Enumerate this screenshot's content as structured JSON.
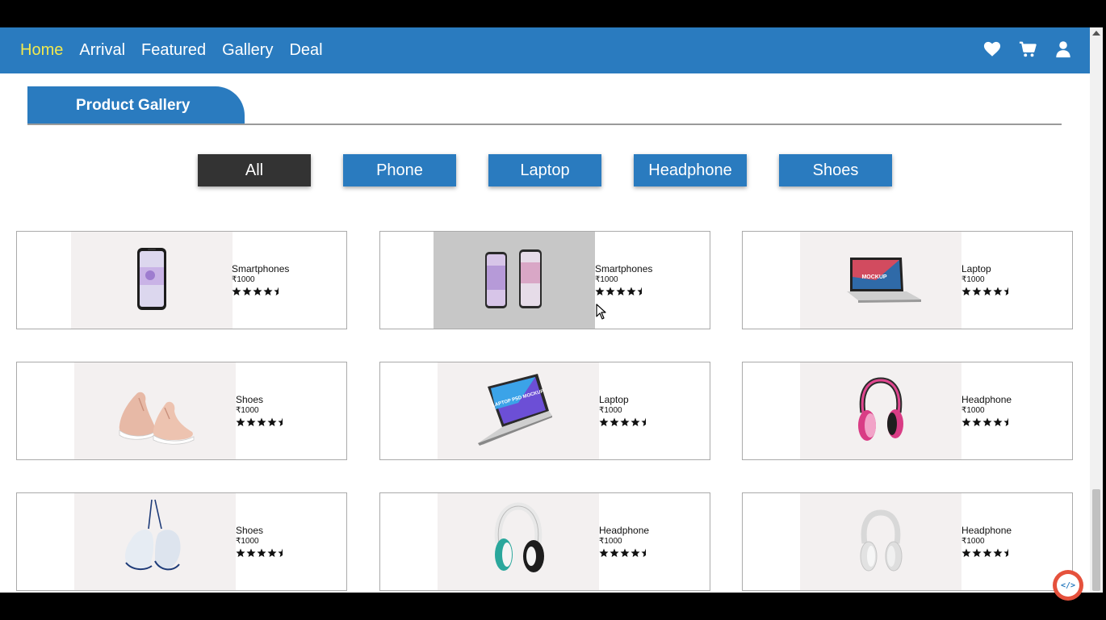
{
  "nav": {
    "links": [
      {
        "label": "Home",
        "active": true
      },
      {
        "label": "Arrival"
      },
      {
        "label": "Featured"
      },
      {
        "label": "Gallery"
      },
      {
        "label": "Deal"
      }
    ],
    "icons": [
      "heart-icon",
      "cart-icon",
      "user-icon"
    ]
  },
  "gallery": {
    "title": "Product Gallery"
  },
  "filters": [
    {
      "label": "All",
      "active": true
    },
    {
      "label": "Phone"
    },
    {
      "label": "Laptop"
    },
    {
      "label": "Headphone"
    },
    {
      "label": "Shoes"
    }
  ],
  "products": [
    {
      "name": "Smartphones",
      "price": "₹1000",
      "rating": 4.5,
      "image": "smartphone"
    },
    {
      "name": "Smartphones",
      "price": "₹1000",
      "rating": 4.5,
      "image": "two-smartphones"
    },
    {
      "name": "Laptop",
      "price": "₹1000",
      "rating": 4.5,
      "image": "laptop-mockup"
    },
    {
      "name": "Shoes",
      "price": "₹1000",
      "rating": 4.5,
      "image": "pink-sneakers"
    },
    {
      "name": "Laptop",
      "price": "₹1000",
      "rating": 4.5,
      "image": "laptop-tilted"
    },
    {
      "name": "Headphone",
      "price": "₹1000",
      "rating": 4.5,
      "image": "pink-headphones"
    },
    {
      "name": "Shoes",
      "price": "₹1000",
      "rating": 4.5,
      "image": "hanging-sneakers"
    },
    {
      "name": "Headphone",
      "price": "₹1000",
      "rating": 4.5,
      "image": "teal-headphones"
    },
    {
      "name": "Headphone",
      "price": "₹1000",
      "rating": 4.5,
      "image": "white-headphones"
    }
  ],
  "laptop_screen_text": "MOCKUP",
  "laptop_tilted_text": "LAPTOP PSD MOCKUP",
  "badge": {
    "label": "</>"
  },
  "colors": {
    "primary": "#2a7bbf",
    "active_nav": "#f2e94e",
    "active_filter": "#333333"
  }
}
